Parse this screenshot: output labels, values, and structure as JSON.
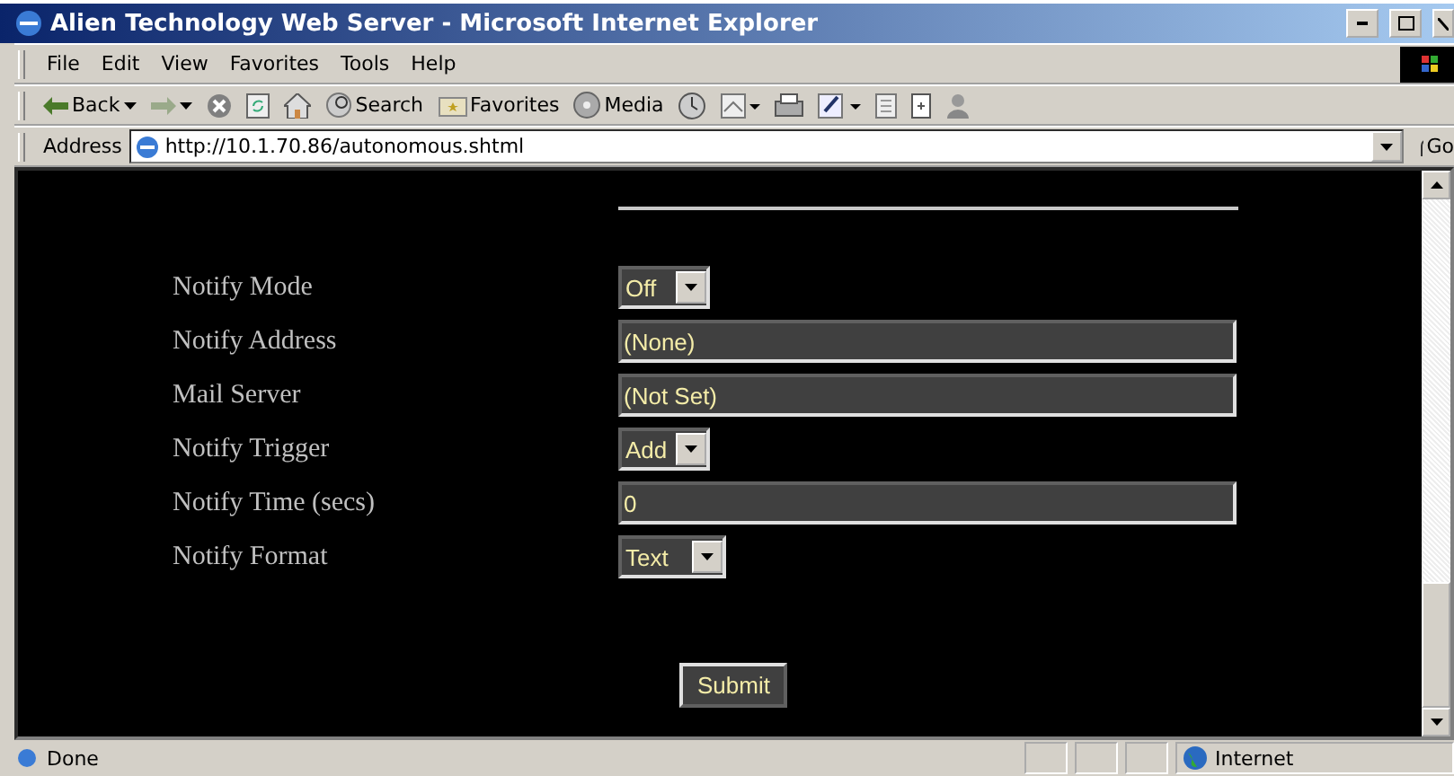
{
  "window": {
    "title": "Alien Technology Web Server - Microsoft Internet Explorer"
  },
  "menu": [
    "File",
    "Edit",
    "View",
    "Favorites",
    "Tools",
    "Help"
  ],
  "toolbar": [
    {
      "kind": "back",
      "label": "Back"
    },
    {
      "kind": "forward"
    },
    {
      "kind": "stop"
    },
    {
      "kind": "refresh"
    },
    {
      "kind": "home"
    },
    {
      "kind": "search",
      "label": "Search"
    },
    {
      "kind": "favorites",
      "label": "Favorites"
    },
    {
      "kind": "media",
      "label": "Media"
    },
    {
      "kind": "history"
    },
    {
      "kind": "mail"
    },
    {
      "kind": "print"
    },
    {
      "kind": "edit"
    },
    {
      "kind": "discuss"
    },
    {
      "kind": "research"
    },
    {
      "kind": "messenger"
    }
  ],
  "address": {
    "label": "Address",
    "value": "http://10.1.70.86/autonomous.shtml",
    "go": "Go"
  },
  "form": {
    "rows": [
      {
        "label": "Notify Mode",
        "kind": "select",
        "value": "Off"
      },
      {
        "label": "Notify Address",
        "kind": "text",
        "value": "(None)"
      },
      {
        "label": "Mail Server",
        "kind": "text",
        "value": "(Not Set)"
      },
      {
        "label": "Notify Trigger",
        "kind": "select",
        "value": "Add"
      },
      {
        "label": "Notify Time (secs)",
        "kind": "text",
        "value": "0"
      },
      {
        "label": "Notify Format",
        "kind": "select",
        "value": "Text"
      }
    ],
    "submit": "Submit"
  },
  "status_bar": {
    "text": "Done",
    "zone": "Internet"
  }
}
